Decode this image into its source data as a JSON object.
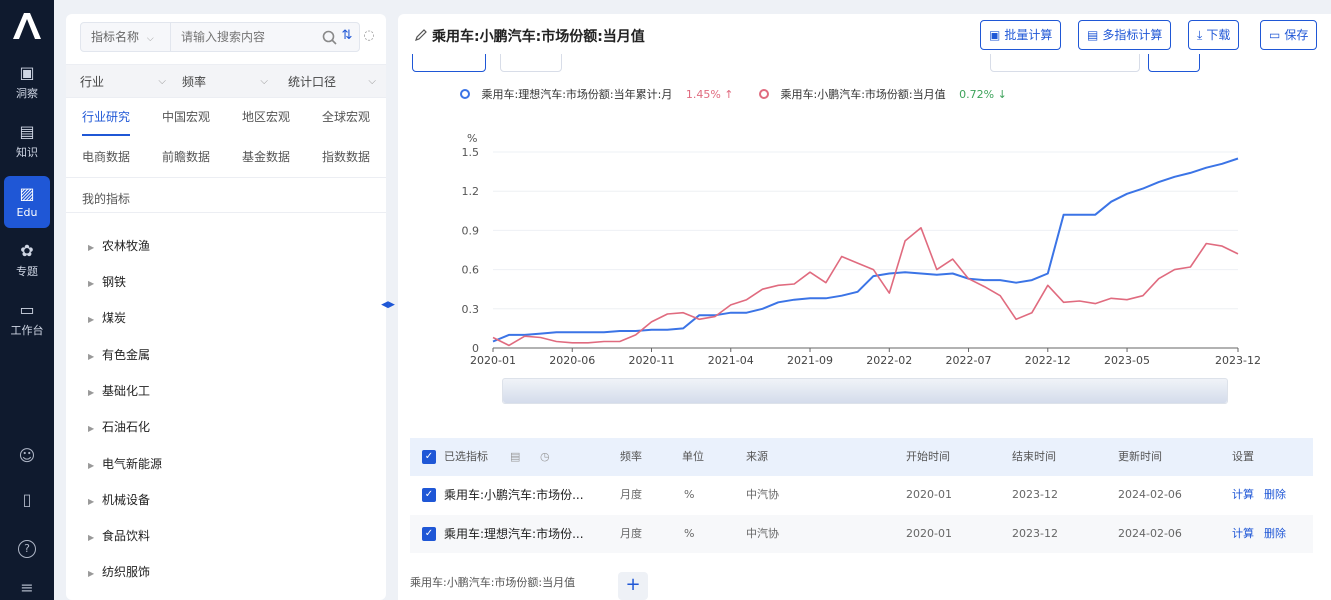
{
  "app": {
    "logo": "A"
  },
  "rail": {
    "items": [
      {
        "label": "洞察",
        "icon": "briefcase-icon",
        "glyph": "▣"
      },
      {
        "label": "知识",
        "icon": "book-icon",
        "glyph": "▤"
      },
      {
        "label": "Edu",
        "icon": "chart-icon",
        "glyph": "▨"
      },
      {
        "label": "专题",
        "icon": "topic-icon",
        "glyph": "✿"
      },
      {
        "label": "工作台",
        "icon": "desk-icon",
        "glyph": "▭"
      }
    ],
    "bottom": [
      {
        "icon": "chat-icon",
        "glyph": "☺"
      },
      {
        "icon": "phone-icon",
        "glyph": "▯"
      },
      {
        "icon": "help-icon",
        "glyph": "?"
      },
      {
        "icon": "menu-icon",
        "glyph": "≡"
      }
    ]
  },
  "sidebar": {
    "search": {
      "field": "指标名称",
      "placeholder": "请输入搜索内容"
    },
    "filters": [
      "行业",
      "频率",
      "统计口径"
    ],
    "tabs_row1": [
      "行业研究",
      "中国宏观",
      "地区宏观",
      "全球宏观"
    ],
    "tabs_row2": [
      "电商数据",
      "前瞻数据",
      "基金数据",
      "指数数据"
    ],
    "mine": "我的指标",
    "tree": [
      "农林牧渔",
      "钢铁",
      "煤炭",
      "有色金属",
      "基础化工",
      "石油石化",
      "电气新能源",
      "机械设备",
      "食品饮料",
      "纺织服饰"
    ]
  },
  "main": {
    "title": "乘用车:小鹏汽车:市场份额:当月值",
    "buttons": [
      {
        "label": "批量计算",
        "icon": "batch-icon"
      },
      {
        "label": "多指标计算",
        "icon": "multi-calc-icon"
      },
      {
        "label": "下载",
        "icon": "download-icon"
      },
      {
        "label": "保存",
        "icon": "save-icon"
      }
    ]
  },
  "chart_data": {
    "type": "line",
    "title": "",
    "xlabel": "",
    "ylabel": "%",
    "ylim": [
      0,
      1.5
    ],
    "yticks": [
      "0",
      "0.3",
      "0.6",
      "0.9",
      "1.2",
      "1.5"
    ],
    "xticks": [
      "2020-01",
      "2020-06",
      "2020-11",
      "2021-04",
      "2021-09",
      "2022-02",
      "2022-07",
      "2022-12",
      "2023-05",
      "2023-12"
    ],
    "x": [
      "2020-01",
      "2020-02",
      "2020-03",
      "2020-04",
      "2020-05",
      "2020-06",
      "2020-07",
      "2020-08",
      "2020-09",
      "2020-10",
      "2020-11",
      "2020-12",
      "2021-01",
      "2021-02",
      "2021-03",
      "2021-04",
      "2021-05",
      "2021-06",
      "2021-07",
      "2021-08",
      "2021-09",
      "2021-10",
      "2021-11",
      "2021-12",
      "2022-01",
      "2022-02",
      "2022-03",
      "2022-04",
      "2022-05",
      "2022-06",
      "2022-07",
      "2022-08",
      "2022-09",
      "2022-10",
      "2022-11",
      "2022-12",
      "2023-01",
      "2023-02",
      "2023-03",
      "2023-04",
      "2023-05",
      "2023-06",
      "2023-07",
      "2023-08",
      "2023-09",
      "2023-10",
      "2023-11",
      "2023-12"
    ],
    "series": [
      {
        "name": "乘用车:理想汽车:市场份额:当年累计:月",
        "color": "#3b74e6",
        "last_label": "1.45%",
        "trend": "up",
        "values": [
          0.05,
          0.1,
          0.1,
          0.11,
          0.12,
          0.12,
          0.12,
          0.12,
          0.13,
          0.13,
          0.14,
          0.14,
          0.15,
          0.25,
          0.25,
          0.27,
          0.27,
          0.3,
          0.35,
          0.37,
          0.38,
          0.38,
          0.4,
          0.43,
          0.55,
          0.57,
          0.58,
          0.57,
          0.56,
          0.57,
          0.53,
          0.52,
          0.52,
          0.5,
          0.52,
          0.57,
          1.02,
          1.02,
          1.02,
          1.12,
          1.18,
          1.22,
          1.27,
          1.31,
          1.34,
          1.38,
          1.41,
          1.45
        ]
      },
      {
        "name": "乘用车:小鹏汽车:市场份额:当月值",
        "color": "#e06b7f",
        "last_label": "0.72%",
        "trend": "down",
        "values": [
          0.08,
          0.02,
          0.09,
          0.08,
          0.05,
          0.04,
          0.04,
          0.05,
          0.05,
          0.1,
          0.2,
          0.26,
          0.27,
          0.22,
          0.24,
          0.33,
          0.37,
          0.45,
          0.48,
          0.49,
          0.58,
          0.5,
          0.7,
          0.65,
          0.6,
          0.42,
          0.82,
          0.92,
          0.6,
          0.68,
          0.53,
          0.47,
          0.4,
          0.22,
          0.27,
          0.48,
          0.35,
          0.36,
          0.34,
          0.38,
          0.37,
          0.4,
          0.53,
          0.6,
          0.62,
          0.8,
          0.78,
          0.72
        ]
      }
    ],
    "legend_position": "top",
    "grid": "horizontal"
  },
  "table": {
    "headers": [
      "已选指标",
      "频率",
      "单位",
      "来源",
      "开始时间",
      "结束时间",
      "更新时间",
      "设置"
    ],
    "rows": [
      {
        "name": "乘用车:小鹏汽车:市场份...",
        "freq": "月度",
        "unit": "%",
        "source": "中汽协",
        "start": "2020-01",
        "end": "2023-12",
        "updated": "2024-02-06",
        "action1": "计算",
        "action2": "删除"
      },
      {
        "name": "乘用车:理想汽车:市场份...",
        "freq": "月度",
        "unit": "%",
        "source": "中汽协",
        "start": "2020-01",
        "end": "2023-12",
        "updated": "2024-02-06",
        "action1": "计算",
        "action2": "删除"
      }
    ]
  },
  "footer": {
    "tab": "乘用车:小鹏汽车:市场份额:当月值",
    "add": "+"
  }
}
